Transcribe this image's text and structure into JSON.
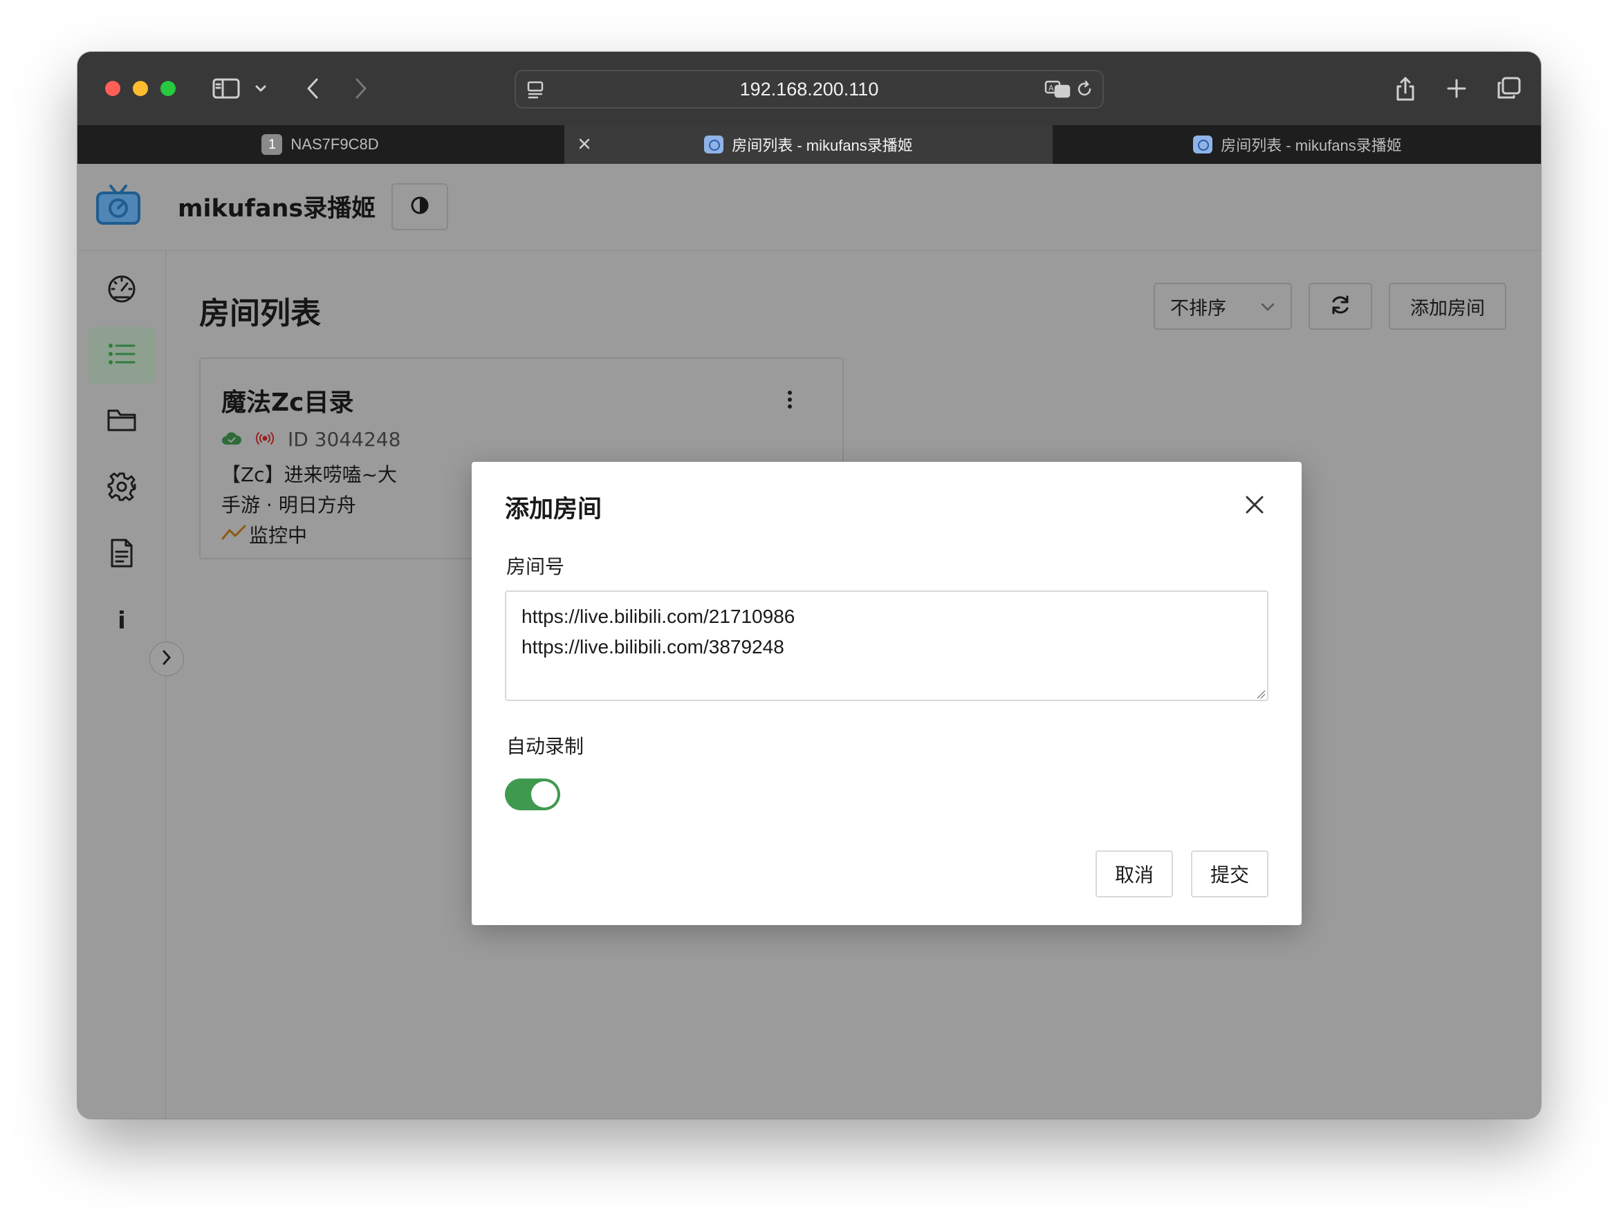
{
  "browser": {
    "url": "192.168.200.110",
    "tabs": [
      {
        "label": "NAS7F9C8D",
        "badge": "1"
      },
      {
        "label": "房间列表 - mikufans录播姬"
      },
      {
        "label": "房间列表 - mikufans录播姬"
      }
    ]
  },
  "app": {
    "title": "mikufans录播姬",
    "accent_color": "#3f9a50"
  },
  "sidebar": {
    "items": [
      {
        "icon": "dashboard-icon"
      },
      {
        "icon": "list-icon",
        "active": true
      },
      {
        "icon": "folder-icon"
      },
      {
        "icon": "gear-icon"
      },
      {
        "icon": "document-icon"
      },
      {
        "icon": "info-icon",
        "label": "i"
      }
    ]
  },
  "page": {
    "title": "房间列表",
    "sort_value": "不排序",
    "add_room_label": "添加房间"
  },
  "room_card": {
    "name": "魔法Zc目录",
    "id_text": "ID 3044248",
    "live_title": "【Zc】进来唠嗑~大",
    "area": "手游 · 明日方舟",
    "status": "监控中"
  },
  "modal": {
    "title": "添加房间",
    "room_label": "房间号",
    "room_value": "https://live.bilibili.com/21710986\nhttps://live.bilibili.com/3879248",
    "auto_record_label": "自动录制",
    "auto_record_on": true,
    "cancel_label": "取消",
    "submit_label": "提交"
  }
}
